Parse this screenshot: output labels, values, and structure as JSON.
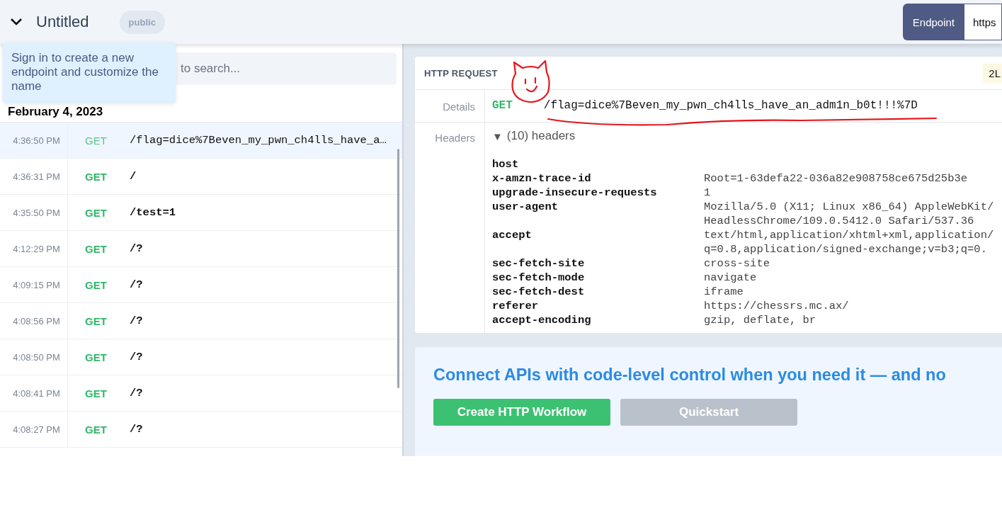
{
  "header": {
    "title": "Untitled",
    "visibility_badge": "public",
    "tooltip": "Sign in to create a new endpoint and customize the name",
    "endpoint_button": "Endpoint",
    "endpoint_url": "https"
  },
  "search": {
    "placeholder": "to search..."
  },
  "request_list": {
    "date": "February 4, 2023",
    "rows": [
      {
        "time": "4:36:50 PM",
        "method": "GET",
        "path": "/flag=dice%7Beven_my_pwn_ch4lls_have_a…",
        "selected": true
      },
      {
        "time": "4:36:31 PM",
        "method": "GET",
        "path": "/",
        "selected": false
      },
      {
        "time": "4:35:50 PM",
        "method": "GET",
        "path": "/test=1",
        "selected": false
      },
      {
        "time": "4:12:29 PM",
        "method": "GET",
        "path": "/?",
        "selected": false
      },
      {
        "time": "4:09:15 PM",
        "method": "GET",
        "path": "/?",
        "selected": false
      },
      {
        "time": "4:08:56 PM",
        "method": "GET",
        "path": "/?",
        "selected": false
      },
      {
        "time": "4:08:50 PM",
        "method": "GET",
        "path": "/?",
        "selected": false
      },
      {
        "time": "4:08:41 PM",
        "method": "GET",
        "path": "/?",
        "selected": false
      },
      {
        "time": "4:08:27 PM",
        "method": "GET",
        "path": "/?",
        "selected": false
      }
    ]
  },
  "http_request": {
    "title": "HTTP REQUEST",
    "badge": "2L",
    "details_label": "Details",
    "method": "GET",
    "path": "/flag=dice%7Beven_my_pwn_ch4lls_have_an_adm1n_b0t!!!%7D",
    "headers_label": "Headers",
    "headers_toggle": {
      "icon": "▼",
      "label": "(10) headers",
      "expanded": true
    },
    "headers": [
      {
        "name": "host"
      },
      {
        "name": "x-amzn-trace-id",
        "value_lines": [
          "Root=1-63defa22-036a82e908758ce675d25b3e"
        ]
      },
      {
        "name": "upgrade-insecure-requests",
        "value_lines": [
          "1"
        ]
      },
      {
        "name": "user-agent",
        "value_lines": [
          "Mozilla/5.0 (X11; Linux x86_64) AppleWebKit/",
          "HeadlessChrome/109.0.5412.0 Safari/537.36"
        ]
      },
      {
        "name": "accept",
        "value_lines": [
          "text/html,application/xhtml+xml,application/",
          "q=0.8,application/signed-exchange;v=b3;q=0."
        ]
      },
      {
        "name": "sec-fetch-site",
        "value_lines": [
          "cross-site"
        ]
      },
      {
        "name": "sec-fetch-mode",
        "value_lines": [
          "navigate"
        ]
      },
      {
        "name": "sec-fetch-dest",
        "value_lines": [
          "iframe"
        ]
      },
      {
        "name": "referer",
        "value_lines": [
          "https://chessrs.mc.ax/"
        ]
      },
      {
        "name": "accept-encoding",
        "value_lines": [
          "gzip, deflate, br"
        ]
      }
    ]
  },
  "promo": {
    "heading": "Connect APIs with code-level control when you need it — and no",
    "buttons": [
      {
        "label": "Create HTTP Workflow",
        "kind": "primary"
      },
      {
        "label": "Quickstart",
        "kind": "secondary"
      }
    ]
  }
}
